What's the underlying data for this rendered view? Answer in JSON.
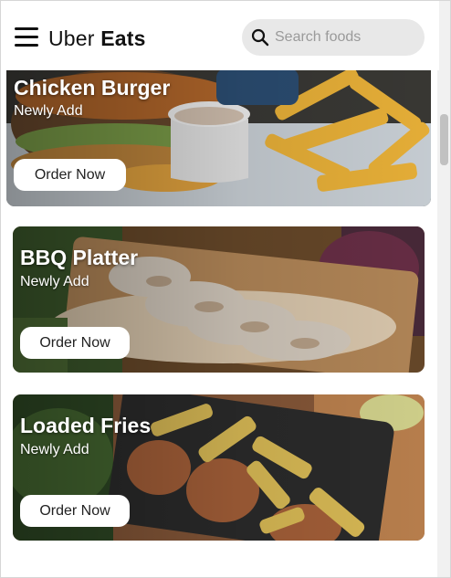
{
  "header": {
    "brand_light": "Uber",
    "brand_bold": "Eats",
    "search_placeholder": "Search foods"
  },
  "icons": {
    "menu": "hamburger-menu-icon",
    "search": "magnifier-icon"
  },
  "colors": {
    "header_bg": "#ffffff",
    "search_bg": "#e8e8e8",
    "button_bg": "#ffffff",
    "text_dark": "#111111"
  },
  "cards": [
    {
      "title": "Chicken Burger",
      "subtitle": "Newly Add",
      "button": "Order Now"
    },
    {
      "title": "BBQ Platter",
      "subtitle": "Newly Add",
      "button": "Order Now"
    },
    {
      "title": "Loaded Fries",
      "subtitle": "Newly Add",
      "button": "Order Now"
    }
  ]
}
